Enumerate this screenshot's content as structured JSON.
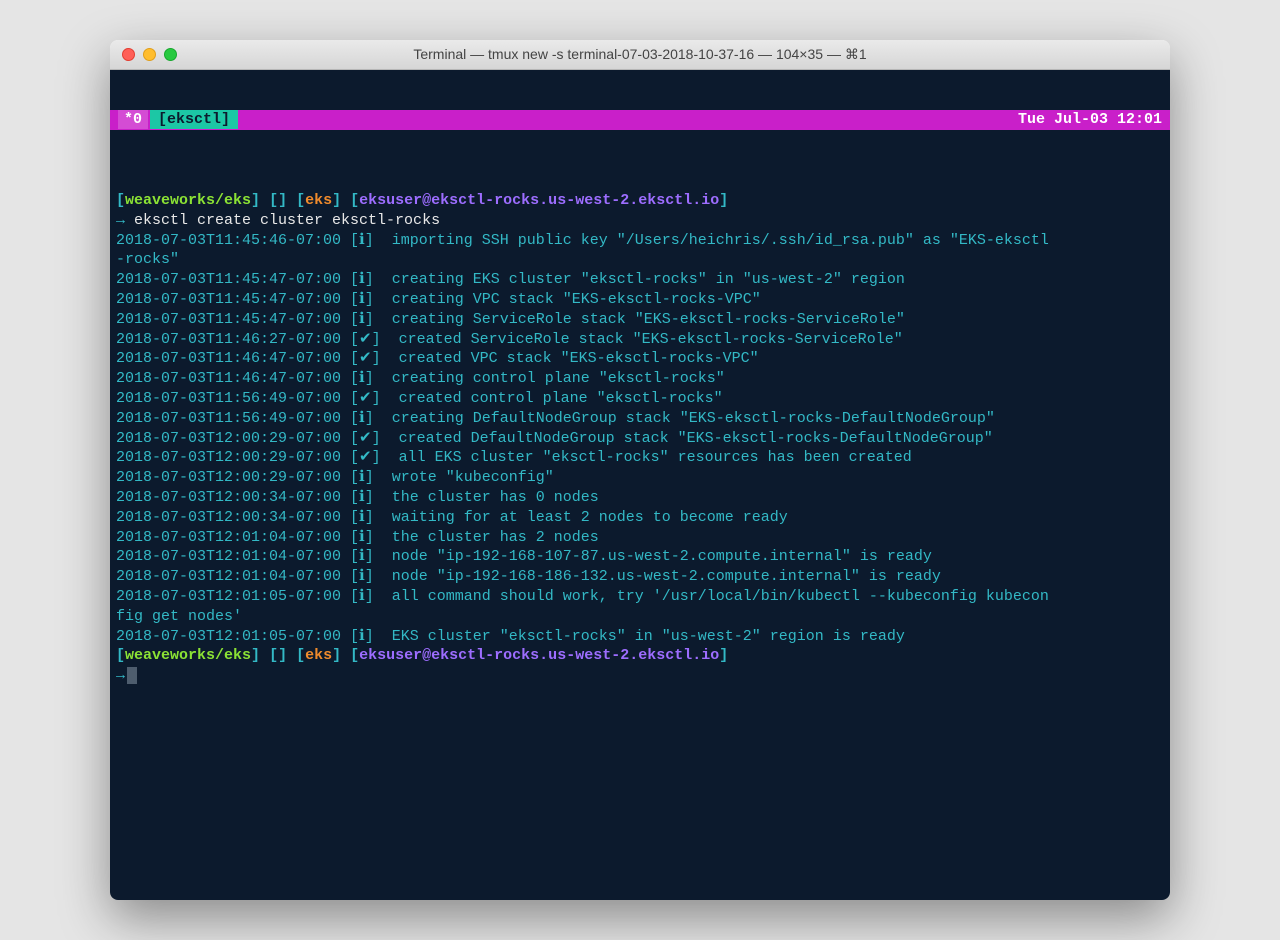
{
  "window": {
    "title": "Terminal — tmux new -s terminal-07-03-2018-10-37-16 — 104×35 — ⌘1"
  },
  "tmux": {
    "tab_index": "*0",
    "tab_name": "[eksctl]",
    "clock": "Tue Jul-03 12:01"
  },
  "prompt": {
    "br_open": "[",
    "br_close": "]",
    "repo": "weaveworks/eks",
    "empty": " [] ",
    "ctx": "eks",
    "user": "eksuser@eksctl-rocks.us-west-2.eksctl.io",
    "arrow": "→ "
  },
  "command": "eksctl create cluster eksctl-rocks",
  "final_arrow": "→",
  "lines": [
    {
      "ts": "2018-07-03T11:45:46-07:00",
      "mk": "[ℹ]",
      "msg": "importing SSH public key \"/Users/heichris/.ssh/id_rsa.pub\" as \"EKS-eksctl"
    },
    {
      "cont": "-rocks\""
    },
    {
      "ts": "2018-07-03T11:45:47-07:00",
      "mk": "[ℹ]",
      "msg": "creating EKS cluster \"eksctl-rocks\" in \"us-west-2\" region"
    },
    {
      "ts": "2018-07-03T11:45:47-07:00",
      "mk": "[ℹ]",
      "msg": "creating VPC stack \"EKS-eksctl-rocks-VPC\""
    },
    {
      "ts": "2018-07-03T11:45:47-07:00",
      "mk": "[ℹ]",
      "msg": "creating ServiceRole stack \"EKS-eksctl-rocks-ServiceRole\""
    },
    {
      "ts": "2018-07-03T11:46:27-07:00",
      "mk": "[✔]",
      "msg": "created ServiceRole stack \"EKS-eksctl-rocks-ServiceRole\""
    },
    {
      "ts": "2018-07-03T11:46:47-07:00",
      "mk": "[✔]",
      "msg": "created VPC stack \"EKS-eksctl-rocks-VPC\""
    },
    {
      "ts": "2018-07-03T11:46:47-07:00",
      "mk": "[ℹ]",
      "msg": "creating control plane \"eksctl-rocks\""
    },
    {
      "ts": "2018-07-03T11:56:49-07:00",
      "mk": "[✔]",
      "msg": "created control plane \"eksctl-rocks\""
    },
    {
      "ts": "2018-07-03T11:56:49-07:00",
      "mk": "[ℹ]",
      "msg": "creating DefaultNodeGroup stack \"EKS-eksctl-rocks-DefaultNodeGroup\""
    },
    {
      "ts": "2018-07-03T12:00:29-07:00",
      "mk": "[✔]",
      "msg": "created DefaultNodeGroup stack \"EKS-eksctl-rocks-DefaultNodeGroup\""
    },
    {
      "ts": "2018-07-03T12:00:29-07:00",
      "mk": "[✔]",
      "msg": "all EKS cluster \"eksctl-rocks\" resources has been created"
    },
    {
      "ts": "2018-07-03T12:00:29-07:00",
      "mk": "[ℹ]",
      "msg": "wrote \"kubeconfig\""
    },
    {
      "ts": "2018-07-03T12:00:34-07:00",
      "mk": "[ℹ]",
      "msg": "the cluster has 0 nodes"
    },
    {
      "ts": "2018-07-03T12:00:34-07:00",
      "mk": "[ℹ]",
      "msg": "waiting for at least 2 nodes to become ready"
    },
    {
      "ts": "2018-07-03T12:01:04-07:00",
      "mk": "[ℹ]",
      "msg": "the cluster has 2 nodes"
    },
    {
      "ts": "2018-07-03T12:01:04-07:00",
      "mk": "[ℹ]",
      "msg": "node \"ip-192-168-107-87.us-west-2.compute.internal\" is ready"
    },
    {
      "ts": "2018-07-03T12:01:04-07:00",
      "mk": "[ℹ]",
      "msg": "node \"ip-192-168-186-132.us-west-2.compute.internal\" is ready"
    },
    {
      "ts": "2018-07-03T12:01:05-07:00",
      "mk": "[ℹ]",
      "msg": "all command should work, try '/usr/local/bin/kubectl --kubeconfig kubecon"
    },
    {
      "cont": "fig get nodes'"
    },
    {
      "ts": "2018-07-03T12:01:05-07:00",
      "mk": "[ℹ]",
      "msg": "EKS cluster \"eksctl-rocks\" in \"us-west-2\" region is ready"
    }
  ]
}
